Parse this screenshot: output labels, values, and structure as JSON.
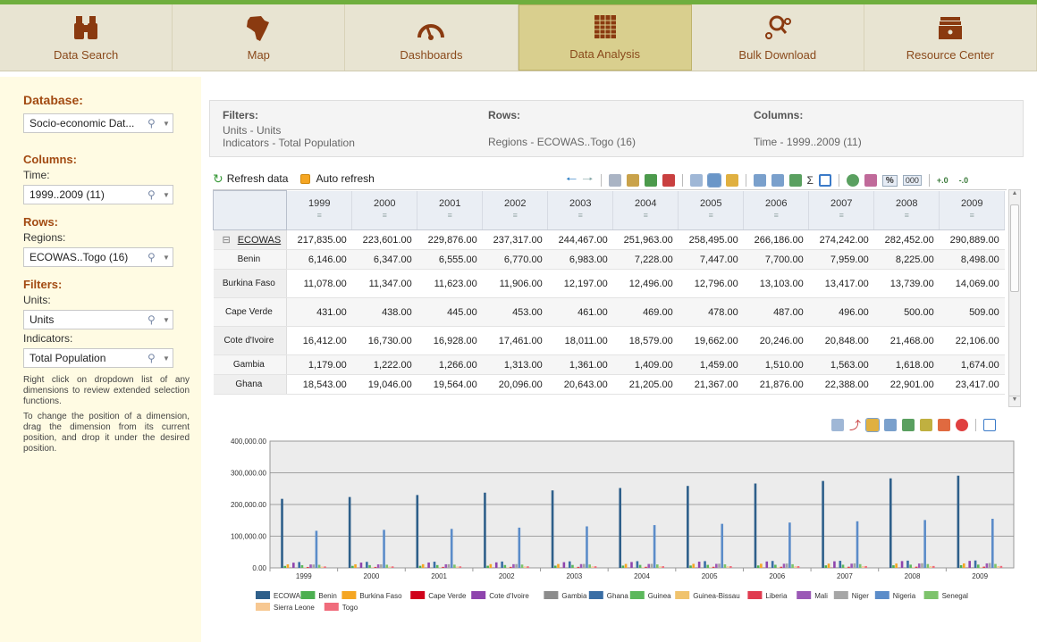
{
  "nav": {
    "items": [
      {
        "label": "Data Search",
        "icon": "binoculars-icon"
      },
      {
        "label": "Map",
        "icon": "africa-map-icon"
      },
      {
        "label": "Dashboards",
        "icon": "gauge-icon"
      },
      {
        "label": "Data Analysis",
        "icon": "grid-table-icon",
        "active": true
      },
      {
        "label": "Bulk Download",
        "icon": "download-search-icon"
      },
      {
        "label": "Resource Center",
        "icon": "archive-box-icon"
      }
    ]
  },
  "sidebar": {
    "database_title": "Database:",
    "database_value": "Socio-economic Dat...",
    "columns_title": "Columns:",
    "time_label": "Time:",
    "time_value": "1999..2009 (11)",
    "rows_title": "Rows:",
    "regions_label": "Regions:",
    "regions_value": "ECOWAS..Togo (16)",
    "filters_title": "Filters:",
    "units_label": "Units:",
    "units_value": "Units",
    "indicators_label": "Indicators:",
    "indicators_value": "Total Population",
    "note1": "Right click on dropdown list of any dimensions to review extended selection functions.",
    "note2": "To change the position of a dimension, drag the dimension from its current position, and drop it under the desired position."
  },
  "filters": {
    "filters_title": "Filters:",
    "filters_line1": "Units - Units",
    "filters_line2": "Indicators - Total Population",
    "rows_title": "Rows:",
    "rows_value": "Regions - ECOWAS..Togo (16)",
    "columns_title": "Columns:",
    "columns_value": "Time - 1999..2009 (11)"
  },
  "toolbar": {
    "refresh_label": "Refresh data",
    "auto_refresh_label": "Auto refresh",
    "percent_label": "%",
    "thousands_label": "000"
  },
  "table": {
    "years": [
      "1999",
      "2000",
      "2001",
      "2002",
      "2003",
      "2004",
      "2005",
      "2006",
      "2007",
      "2008",
      "2009"
    ],
    "rows": [
      {
        "name": "ECOWAS",
        "values": [
          "217,835.00",
          "223,601.00",
          "229,876.00",
          "237,317.00",
          "244,467.00",
          "251,963.00",
          "258,495.00",
          "266,186.00",
          "274,242.00",
          "282,452.00",
          "290,889.00"
        ]
      },
      {
        "name": "Benin",
        "values": [
          "6,146.00",
          "6,347.00",
          "6,555.00",
          "6,770.00",
          "6,983.00",
          "7,228.00",
          "7,447.00",
          "7,700.00",
          "7,959.00",
          "8,225.00",
          "8,498.00"
        ]
      },
      {
        "name": "Burkina Faso",
        "values": [
          "11,078.00",
          "11,347.00",
          "11,623.00",
          "11,906.00",
          "12,197.00",
          "12,496.00",
          "12,796.00",
          "13,103.00",
          "13,417.00",
          "13,739.00",
          "14,069.00"
        ]
      },
      {
        "name": "Cape Verde",
        "values": [
          "431.00",
          "438.00",
          "445.00",
          "453.00",
          "461.00",
          "469.00",
          "478.00",
          "487.00",
          "496.00",
          "500.00",
          "509.00"
        ]
      },
      {
        "name": "Cote d'Ivoire",
        "values": [
          "16,412.00",
          "16,730.00",
          "16,928.00",
          "17,461.00",
          "18,011.00",
          "18,579.00",
          "19,662.00",
          "20,246.00",
          "20,848.00",
          "21,468.00",
          "22,106.00"
        ]
      },
      {
        "name": "Gambia",
        "values": [
          "1,179.00",
          "1,222.00",
          "1,266.00",
          "1,313.00",
          "1,361.00",
          "1,409.00",
          "1,459.00",
          "1,510.00",
          "1,563.00",
          "1,618.00",
          "1,674.00"
        ]
      },
      {
        "name": "Ghana",
        "values": [
          "18,543.00",
          "19,046.00",
          "19,564.00",
          "20,096.00",
          "20,643.00",
          "21,205.00",
          "21,367.00",
          "21,876.00",
          "22,388.00",
          "22,901.00",
          "23,417.00"
        ]
      }
    ]
  },
  "chart_data": {
    "type": "bar",
    "categories": [
      "1999",
      "2000",
      "2001",
      "2002",
      "2003",
      "2004",
      "2005",
      "2006",
      "2007",
      "2008",
      "2009"
    ],
    "ylim": [
      0,
      400000
    ],
    "yticks": [
      "0.00",
      "100,000.00",
      "200,000.00",
      "300,000.00",
      "400,000.00"
    ],
    "series": [
      {
        "name": "ECOWAS",
        "color": "#2e5f8a",
        "values": [
          217835,
          223601,
          229876,
          237317,
          244467,
          251963,
          258495,
          266186,
          274242,
          282452,
          290889
        ]
      },
      {
        "name": "Benin",
        "color": "#4caf50",
        "values": [
          6146,
          6347,
          6555,
          6770,
          6983,
          7228,
          7447,
          7700,
          7959,
          8225,
          8498
        ]
      },
      {
        "name": "Burkina Faso",
        "color": "#f5a623",
        "values": [
          11078,
          11347,
          11623,
          11906,
          12197,
          12496,
          12796,
          13103,
          13417,
          13739,
          14069
        ]
      },
      {
        "name": "Cape Verde",
        "color": "#d0021b",
        "values": [
          431,
          438,
          445,
          453,
          461,
          469,
          478,
          487,
          496,
          500,
          509
        ]
      },
      {
        "name": "Cote d'Ivoire",
        "color": "#8e44ad",
        "values": [
          16412,
          16730,
          16928,
          17461,
          18011,
          18579,
          19662,
          20246,
          20848,
          21468,
          22106
        ]
      },
      {
        "name": "Gambia",
        "color": "#8c8c8c",
        "values": [
          1179,
          1222,
          1266,
          1313,
          1361,
          1409,
          1459,
          1510,
          1563,
          1618,
          1674
        ]
      },
      {
        "name": "Ghana",
        "color": "#3a6ea5",
        "values": [
          18543,
          19046,
          19564,
          20096,
          20643,
          21205,
          21367,
          21876,
          22388,
          22901,
          23417
        ]
      },
      {
        "name": "Guinea",
        "color": "#5cb85c",
        "values": [
          8600,
          8750,
          8900,
          9050,
          9200,
          9400,
          9600,
          9800,
          10000,
          10200,
          10400
        ]
      },
      {
        "name": "Guinea-Bissau",
        "color": "#f0c36d",
        "values": [
          1300,
          1330,
          1360,
          1390,
          1420,
          1450,
          1490,
          1520,
          1560,
          1600,
          1640
        ]
      },
      {
        "name": "Liberia",
        "color": "#e03c50",
        "values": [
          2900,
          3000,
          3100,
          3200,
          3300,
          3400,
          3500,
          3600,
          3700,
          3800,
          3950
        ]
      },
      {
        "name": "Mali",
        "color": "#9b59b6",
        "values": [
          10800,
          11100,
          11400,
          11700,
          12000,
          12300,
          12700,
          13000,
          13400,
          13800,
          14200
        ]
      },
      {
        "name": "Niger",
        "color": "#a6a6a6",
        "values": [
          10700,
          11100,
          11500,
          11900,
          12300,
          12700,
          13200,
          13700,
          14200,
          14700,
          15300
        ]
      },
      {
        "name": "Nigeria",
        "color": "#5b8cc9",
        "values": [
          117000,
          120000,
          123000,
          127000,
          131000,
          135000,
          139000,
          143000,
          147000,
          151000,
          155000
        ]
      },
      {
        "name": "Senegal",
        "color": "#7dc36b",
        "values": [
          9700,
          9950,
          10200,
          10450,
          10700,
          10950,
          11200,
          11500,
          11800,
          12100,
          12400
        ]
      },
      {
        "name": "Sierra Leone",
        "color": "#f7c892",
        "values": [
          4100,
          4250,
          4400,
          4550,
          4700,
          4850,
          5000,
          5150,
          5300,
          5450,
          5600
        ]
      },
      {
        "name": "Togo",
        "color": "#f06c7c",
        "values": [
          4600,
          4750,
          4900,
          5050,
          5200,
          5350,
          5500,
          5650,
          5800,
          5950,
          6100
        ]
      }
    ]
  }
}
